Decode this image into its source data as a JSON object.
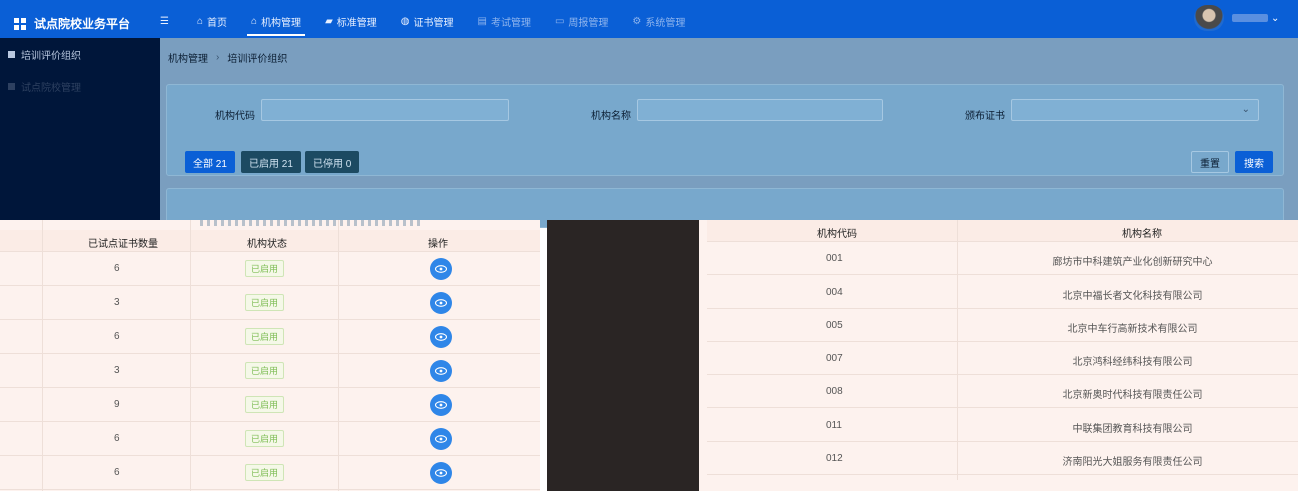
{
  "header": {
    "app_title": "试点院校业务平台",
    "nav": [
      {
        "label": "首页",
        "icon": "home-icon"
      },
      {
        "label": "机构管理",
        "icon": "org-icon",
        "active": true
      },
      {
        "label": "标准管理",
        "icon": "book-icon"
      },
      {
        "label": "证书管理",
        "icon": "certificate-icon"
      },
      {
        "label": "考试管理",
        "icon": "exam-icon"
      },
      {
        "label": "周报管理",
        "icon": "report-icon"
      },
      {
        "label": "系统管理",
        "icon": "gear-icon"
      }
    ],
    "accent_color": "#0a5fd6"
  },
  "sidebar": {
    "items": [
      {
        "label": "培训评价组织",
        "active": true
      },
      {
        "label": "试点院校管理",
        "active": false
      }
    ]
  },
  "breadcrumb": {
    "parent": "机构管理",
    "current": "培训评价组织"
  },
  "filters": {
    "org_code_label": "机构代码",
    "org_code_value": "",
    "org_name_label": "机构名称",
    "org_name_value": "",
    "cert_label": "颁布证书",
    "cert_value": ""
  },
  "status_tabs": {
    "all": "全部 21",
    "enabled": "已启用 21",
    "disabled": "已停用 0"
  },
  "actions": {
    "reset": "重置",
    "search": "搜索"
  },
  "left_table": {
    "columns": [
      "已试点证书数量",
      "机构状态",
      "操作"
    ],
    "rows": [
      {
        "count": "6",
        "status": "已启用"
      },
      {
        "count": "3",
        "status": "已启用"
      },
      {
        "count": "6",
        "status": "已启用"
      },
      {
        "count": "3",
        "status": "已启用"
      },
      {
        "count": "9",
        "status": "已启用"
      },
      {
        "count": "6",
        "status": "已启用"
      },
      {
        "count": "6",
        "status": "已启用"
      }
    ]
  },
  "right_table": {
    "columns": [
      "机构代码",
      "机构名称"
    ],
    "rows": [
      {
        "code": "001",
        "name": "廊坊市中科建筑产业化创新研究中心"
      },
      {
        "code": "004",
        "name": "北京中福长者文化科技有限公司"
      },
      {
        "code": "005",
        "name": "北京中车行高新技术有限公司"
      },
      {
        "code": "007",
        "name": "北京鸿科经纬科技有限公司"
      },
      {
        "code": "008",
        "name": "北京新奥时代科技有限责任公司"
      },
      {
        "code": "011",
        "name": "中联集团教育科技有限公司"
      },
      {
        "code": "012",
        "name": "济南阳光大姐服务有限责任公司"
      }
    ]
  }
}
